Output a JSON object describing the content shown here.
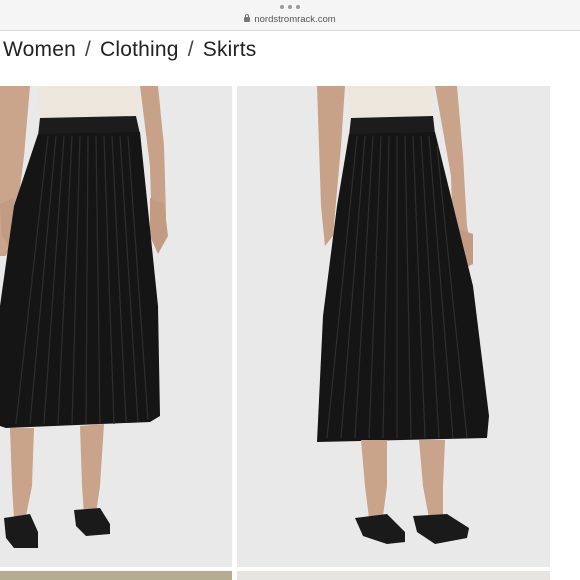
{
  "browser": {
    "url": "nordstromrack.com"
  },
  "breadcrumb": {
    "items": [
      "Women",
      "Clothing",
      "Skirts"
    ],
    "separator": "/"
  },
  "gallery": {
    "images": [
      {
        "subject": "black pleated midi skirt, front view"
      },
      {
        "subject": "black pleated midi skirt, side view"
      }
    ]
  },
  "colors": {
    "background": "#ffffff",
    "photo_background": "#e9e9ea",
    "skirt": "#161616",
    "top": "#ece6dc",
    "skin": "#c9a48a"
  }
}
